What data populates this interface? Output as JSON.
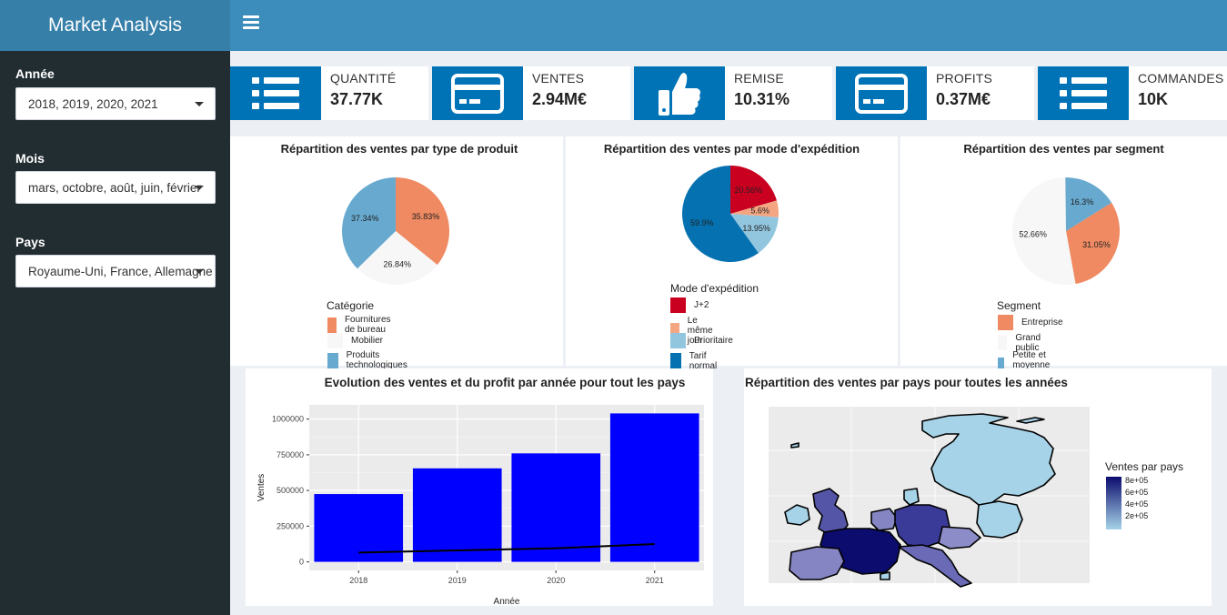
{
  "header": {
    "app_title": "Market Analysis"
  },
  "sidebar": {
    "filters": [
      {
        "label": "Année",
        "value": "2018, 2019, 2020, 2021"
      },
      {
        "label": "Mois",
        "value": "mars, octobre, août, juin, février"
      },
      {
        "label": "Pays",
        "value": "Royaume-Uni, France, Allemagne"
      }
    ]
  },
  "kpis": [
    {
      "label": "QUANTITÉ",
      "value": "37.77K",
      "icon": "list-icon"
    },
    {
      "label": "VENTES",
      "value": "2.94M€",
      "icon": "credit-card-icon"
    },
    {
      "label": "REMISE",
      "value": "10.31%",
      "icon": "thumbs-up-icon"
    },
    {
      "label": "PROFITS",
      "value": "0.37M€",
      "icon": "credit-card-icon"
    },
    {
      "label": "COMMANDES",
      "value": "10K",
      "icon": "list-icon"
    }
  ],
  "colors": {
    "header": "#3c8dbc",
    "logo": "#367fa9",
    "sidebar": "#222d32",
    "kpi_icon": "#0073b7",
    "bar": "#0000ff"
  },
  "chart_data": [
    {
      "type": "pie",
      "title": "Répartition des ventes par type de produit",
      "legend_title": "Catégorie",
      "labels": [
        "Fournitures de bureau",
        "Mobilier",
        "Produits technologiques"
      ],
      "values": [
        35.83,
        26.84,
        37.34
      ],
      "value_labels": [
        "35.83%",
        "26.84%",
        "37.34%"
      ],
      "colors": [
        "#ef8a62",
        "#f7f7f7",
        "#67a9cf"
      ]
    },
    {
      "type": "pie",
      "title": "Répartition des ventes par mode d'expédition",
      "legend_title": "Mode d'expédition",
      "labels": [
        "J+2",
        "Le même jour",
        "Prioritaire",
        "Tarif normal"
      ],
      "values": [
        20.56,
        5.6,
        13.95,
        59.9
      ],
      "value_labels": [
        "20.56%",
        "5.6%",
        "13.95%",
        "59.9%"
      ],
      "colors": [
        "#ca0020",
        "#f4a582",
        "#92c5de",
        "#0571b0"
      ]
    },
    {
      "type": "pie",
      "title": "Répartition des ventes par segment",
      "legend_title": "Segment",
      "labels": [
        "Entreprise",
        "Grand public",
        "Petite et moyenne entreprise"
      ],
      "values": [
        31.05,
        52.66,
        16.3
      ],
      "value_labels": [
        "31.05%",
        "52.66%",
        "16.3%"
      ],
      "colors": [
        "#ef8a62",
        "#f7f7f7",
        "#67a9cf"
      ]
    },
    {
      "type": "bar",
      "title": "Evolution des ventes et du profit par année pour tout les pays",
      "xlabel": "Année",
      "ylabel": "Ventes",
      "categories": [
        "2018",
        "2019",
        "2020",
        "2021"
      ],
      "series": [
        {
          "values": [
            475000,
            655000,
            760000,
            1040000
          ]
        },
        {
          "type": "line",
          "values": [
            65000,
            80000,
            95000,
            125000
          ]
        }
      ],
      "yticks": [
        0,
        250000,
        500000,
        750000,
        1000000
      ],
      "ytick_labels": [
        "0",
        "250000",
        "500000",
        "750000",
        "1000000"
      ],
      "ylim": [
        -60000,
        1100000
      ]
    },
    {
      "type": "map",
      "title": "Répartition des ventes par pays pour toutes les années",
      "legend_title": "Ventes par pays",
      "legend_ticks": [
        "8e+05",
        "6e+05",
        "4e+05",
        "2e+05"
      ],
      "scale_colors": [
        "#0c0c6e",
        "#a6d3e8"
      ]
    }
  ]
}
